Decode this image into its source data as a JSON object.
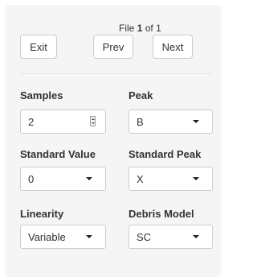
{
  "pager": {
    "prefix": "File",
    "current": "1",
    "middle": "of",
    "total": "1"
  },
  "buttons": {
    "exit": "Exit",
    "prev": "Prev",
    "next": "Next"
  },
  "fields": {
    "samples": {
      "label": "Samples",
      "value": "2"
    },
    "peak": {
      "label": "Peak",
      "value": "B"
    },
    "standard_value": {
      "label": "Standard Value",
      "value": "0"
    },
    "standard_peak": {
      "label": "Standard Peak",
      "value": "X"
    },
    "linearity": {
      "label": "Linearity",
      "value": "Variable"
    },
    "debris_model": {
      "label": "Debris Model",
      "value": "SC"
    }
  },
  "icons": {
    "dropdown": "caret-down-icon",
    "spinner": "spinner-arrows-icon"
  }
}
